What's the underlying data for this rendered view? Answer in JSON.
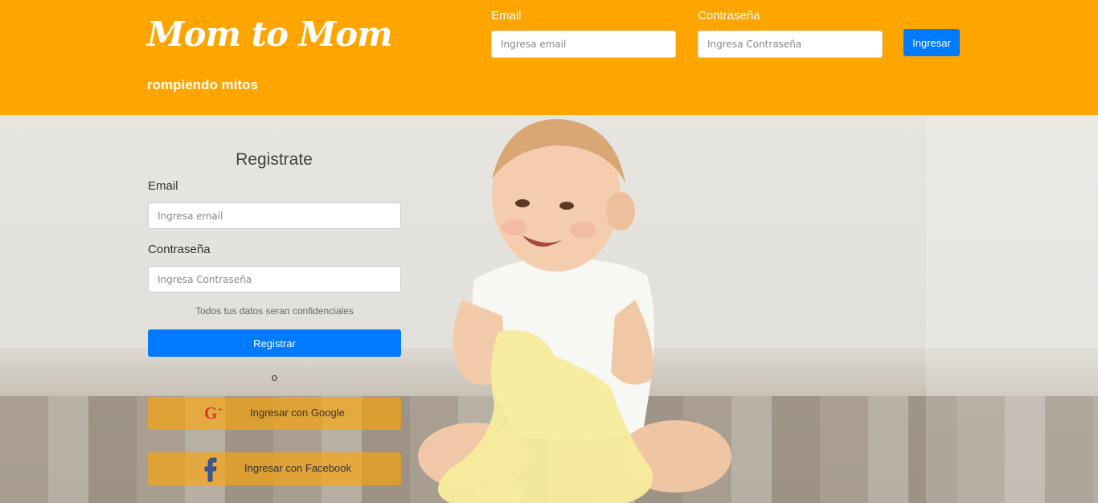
{
  "header": {
    "brand": "Mom to Mom",
    "tagline": "rompiendo mitos",
    "email_label": "Email",
    "email_placeholder": "Ingresa email",
    "password_label": "Contraseña",
    "password_placeholder": "Ingresa Contraseña",
    "login_button": "Ingresar",
    "background_color": "#ffa500"
  },
  "register": {
    "title": "Registrate",
    "email_label": "Email",
    "email_placeholder": "Ingresa email",
    "password_label": "Contraseña",
    "password_placeholder": "Ingresa Contraseña",
    "note": "Todos tus datos seran confidenciales",
    "submit_button": "Registrar",
    "or_text": "o",
    "google_button": "Ingresar con Google",
    "facebook_button": "Ingresar con Facebook",
    "button_color": "#007bff"
  },
  "icons": {
    "google": "google-plus-icon",
    "facebook": "facebook-icon"
  }
}
